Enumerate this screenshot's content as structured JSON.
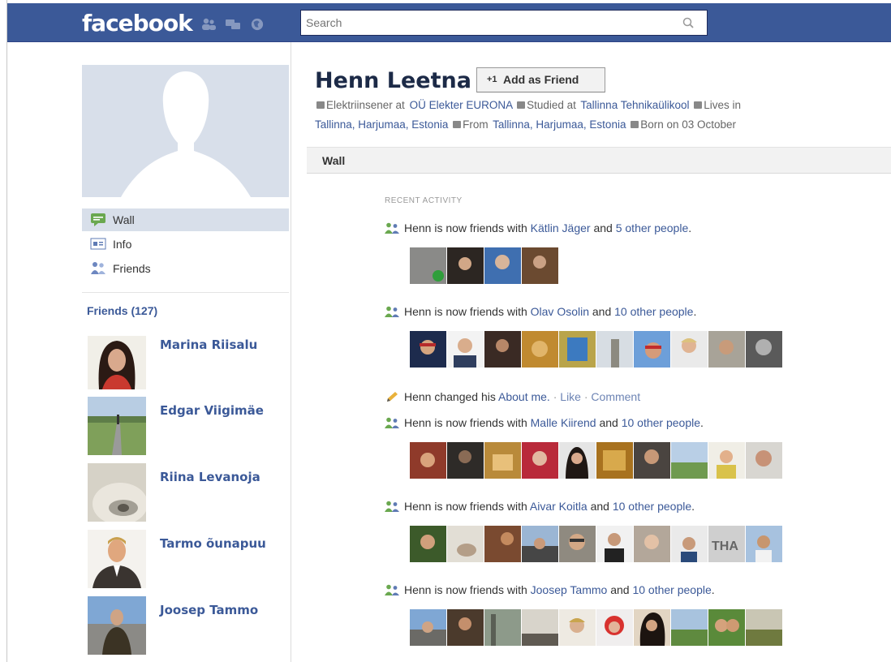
{
  "header": {
    "logo": "facebook",
    "search": {
      "placeholder": "Search"
    },
    "colors": {
      "bar": "#3b5998",
      "link": "#3b5998"
    }
  },
  "sidebar": {
    "nav": [
      {
        "label": "Wall",
        "icon": "wall-icon",
        "active": true
      },
      {
        "label": "Info",
        "icon": "info-icon"
      },
      {
        "label": "Friends",
        "icon": "friends-icon"
      }
    ],
    "friends_heading": "Friends (127)",
    "friends": [
      {
        "name": "Marina Riisalu"
      },
      {
        "name": "Edgar Viigimäe"
      },
      {
        "name": "Riina Levanoja"
      },
      {
        "name": "Tarmo õunapuu"
      },
      {
        "name": "Joosep Tammo"
      }
    ]
  },
  "profile": {
    "name": "Henn Leetna",
    "add_friend": "Add as Friend",
    "info": {
      "work_prefix": "Elektriinsener at",
      "work_link": "OÜ Elekter EURONA",
      "study_prefix": "Studied at",
      "study_link": "Tallinna Tehnikaülikool",
      "lives_prefix": "Lives in",
      "lives_link": "Tallinna, Harjumaa, Estonia",
      "from_prefix": "From",
      "from_link": "Tallinna, Harjumaa, Estonia",
      "born": "Born on 03 October"
    }
  },
  "wall": {
    "tab": "Wall",
    "recent_label": "RECENT ACTIVITY",
    "stories": [
      {
        "type": "friends",
        "actor": "Henn",
        "verb": "is now friends with",
        "friend": "Kätlin Jäger",
        "and": "and",
        "others": "5 other people",
        "end": "."
      },
      {
        "type": "friends",
        "actor": "Henn",
        "verb": "is now friends with",
        "friend": "Olav Osolin",
        "and": "and",
        "others": "10 other people",
        "end": "."
      },
      {
        "type": "about",
        "text_pre": "Henn changed his",
        "link": "About me.",
        "dot1": "·",
        "like": "Like",
        "dot2": "·",
        "comment": "Comment"
      },
      {
        "type": "friends",
        "actor": "Henn",
        "verb": "is now friends with",
        "friend": "Malle Kiirend",
        "and": "and",
        "others": "10 other people",
        "end": "."
      },
      {
        "type": "friends",
        "actor": "Henn",
        "verb": "is now friends with",
        "friend": "Aivar Koitla",
        "and": "and",
        "others": "10 other people",
        "end": "."
      },
      {
        "type": "friends",
        "actor": "Henn",
        "verb": "is now friends with",
        "friend": "Joosep Tammo",
        "and": "and",
        "others": "10 other people",
        "end": "."
      }
    ]
  }
}
